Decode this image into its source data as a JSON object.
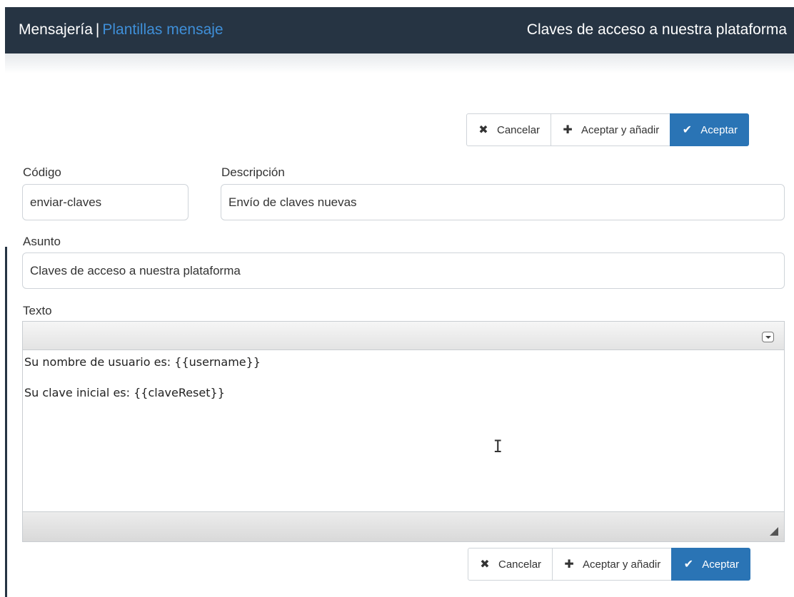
{
  "header": {
    "section": "Mensajería",
    "separator": "|",
    "breadcrumb_link": "Plantillas mensaje",
    "page_title": "Claves de acceso a nuestra plataforma"
  },
  "toolbar": {
    "cancel_label": "Cancelar",
    "accept_add_label": "Aceptar y añadir",
    "accept_label": "Aceptar",
    "cancel_icon": "✖",
    "accept_add_icon": "✚",
    "accept_icon": "✔"
  },
  "form": {
    "codigo_label": "Código",
    "codigo_value": "enviar-claves",
    "descripcion_label": "Descripción",
    "descripcion_value": "Envío de claves nuevas",
    "asunto_label": "Asunto",
    "asunto_value": "Claves de acceso a nuestra plataforma",
    "texto_label": "Texto"
  },
  "editor": {
    "lines": [
      "Su nombre de usuario es: {{username}}",
      "Su clave inicial es: {{claveReset}}"
    ],
    "cursor_glyph": "I"
  },
  "colors": {
    "header_bg": "#263443",
    "link": "#3f8fd8",
    "primary": "#2a74b5"
  }
}
